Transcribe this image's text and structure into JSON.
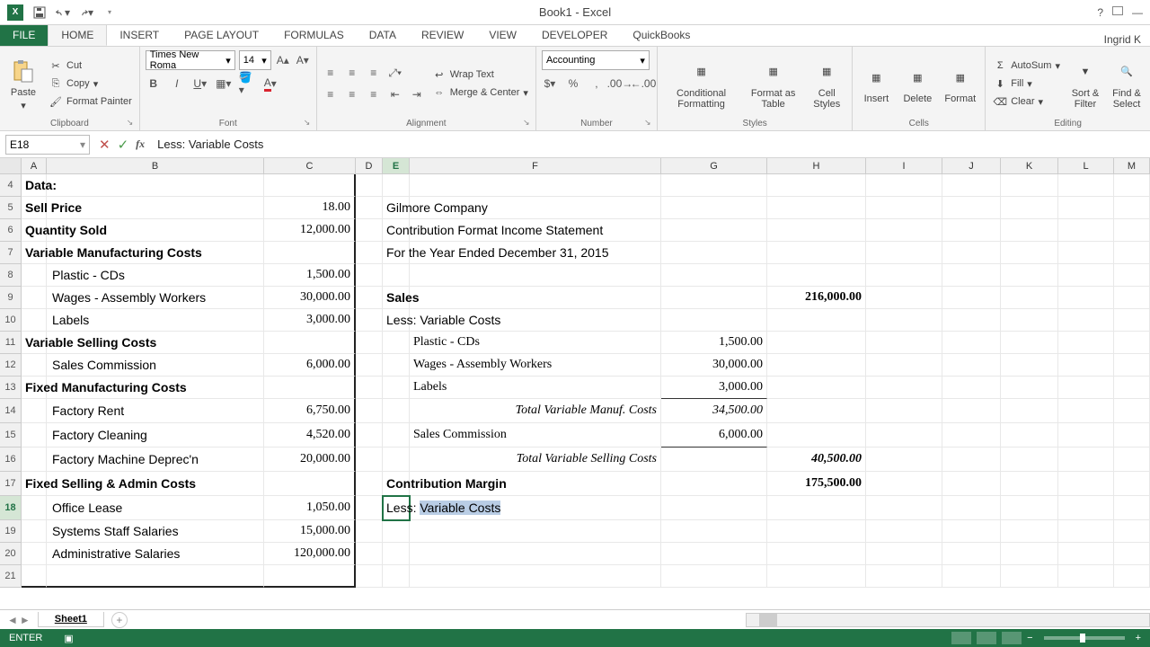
{
  "app": {
    "title": "Book1 - Excel"
  },
  "qat_icons": [
    "save-icon",
    "undo-icon",
    "redo-icon",
    "customize-icon"
  ],
  "title_right_icons": [
    "help-icon",
    "ribbon-display-icon",
    "minimize-icon"
  ],
  "user": "Ingrid K",
  "tabs": {
    "file": "FILE",
    "list": [
      "HOME",
      "INSERT",
      "PAGE LAYOUT",
      "FORMULAS",
      "DATA",
      "REVIEW",
      "VIEW",
      "DEVELOPER",
      "QuickBooks"
    ],
    "active": "HOME"
  },
  "ribbon": {
    "clipboard": {
      "label": "Clipboard",
      "paste": "Paste",
      "cut": "Cut",
      "copy": "Copy",
      "fpainter": "Format Painter"
    },
    "font": {
      "label": "Font",
      "name": "Times New Roma",
      "size": "14"
    },
    "alignment": {
      "label": "Alignment",
      "wrap": "Wrap Text",
      "merge": "Merge & Center"
    },
    "number": {
      "label": "Number",
      "format": "Accounting"
    },
    "styles": {
      "label": "Styles",
      "cond": "Conditional Formatting",
      "fat": "Format as Table",
      "cell": "Cell Styles"
    },
    "cells": {
      "label": "Cells",
      "insert": "Insert",
      "delete": "Delete",
      "format": "Format"
    },
    "editing": {
      "label": "Editing",
      "autosum": "AutoSum",
      "fill": "Fill",
      "clear": "Clear",
      "sort": "Sort & Filter",
      "find": "Find & Select"
    }
  },
  "fbar": {
    "ref": "E18",
    "formula": "Less: Variable Costs"
  },
  "cols": [
    "A",
    "B",
    "C",
    "D",
    "E",
    "F",
    "G",
    "H",
    "I",
    "J",
    "K",
    "L",
    "M"
  ],
  "selected_col": "E",
  "rows": [
    4,
    5,
    6,
    7,
    8,
    9,
    10,
    11,
    12,
    13,
    14,
    15,
    16,
    17,
    18,
    19,
    20,
    21
  ],
  "selected_row": 18,
  "data_block": {
    "title": "Data:",
    "rows": [
      {
        "label": "Sell Price",
        "val": "18.00",
        "bold": true
      },
      {
        "label": "Quantity Sold",
        "val": "12,000.00",
        "bold": true
      },
      {
        "label": "Variable Manufacturing Costs",
        "val": "",
        "bold": true
      },
      {
        "label": "Plastic - CDs",
        "val": "1,500.00",
        "indent": true
      },
      {
        "label": "Wages - Assembly Workers",
        "val": "30,000.00",
        "indent": true
      },
      {
        "label": "Labels",
        "val": "3,000.00",
        "indent": true
      },
      {
        "label": "Variable Selling Costs",
        "val": "",
        "bold": true
      },
      {
        "label": "Sales Commission",
        "val": "6,000.00",
        "indent": true
      },
      {
        "label": "Fixed Manufacturing Costs",
        "val": "",
        "bold": true
      },
      {
        "label": "Factory Rent",
        "val": "6,750.00",
        "indent": true
      },
      {
        "label": "Factory Cleaning",
        "val": "4,520.00",
        "indent": true
      },
      {
        "label": "Factory Machine Deprec'n",
        "val": "20,000.00",
        "indent": true
      },
      {
        "label": "Fixed Selling & Admin Costs",
        "val": "",
        "bold": true
      },
      {
        "label": "Office Lease",
        "val": "1,050.00",
        "indent": true
      },
      {
        "label": "Systems Staff Salaries",
        "val": "15,000.00",
        "indent": true
      },
      {
        "label": "Administrative Salaries",
        "val": "120,000.00",
        "indent": true
      }
    ]
  },
  "income": {
    "company": "Gilmore Company",
    "statement": "Contribution Format Income Statement",
    "period": "For the Year Ended December 31, 2015",
    "sales_label": "Sales",
    "sales_val": "216,000.00",
    "less_var": "Less: Variable Costs",
    "lines": [
      {
        "label": "Plastic - CDs",
        "g": "1,500.00"
      },
      {
        "label": "Wages - Assembly Workers",
        "g": "30,000.00"
      },
      {
        "label": "Labels",
        "g": "3,000.00",
        "ul": true
      }
    ],
    "tvmc_label": "Total Variable Manuf. Costs",
    "tvmc_val": "34,500.00",
    "salescomm_label": "Sales Commission",
    "salescomm_val": "6,000.00",
    "tvsc_label": "Total Variable Selling Costs",
    "tvsc_val": "40,500.00",
    "cm_label": "Contribution Margin",
    "cm_val": "175,500.00",
    "editing_prefix": "Less: ",
    "editing_sel": "Variable Costs"
  },
  "sheet": {
    "name": "Sheet1"
  },
  "status": {
    "mode": "ENTER"
  }
}
